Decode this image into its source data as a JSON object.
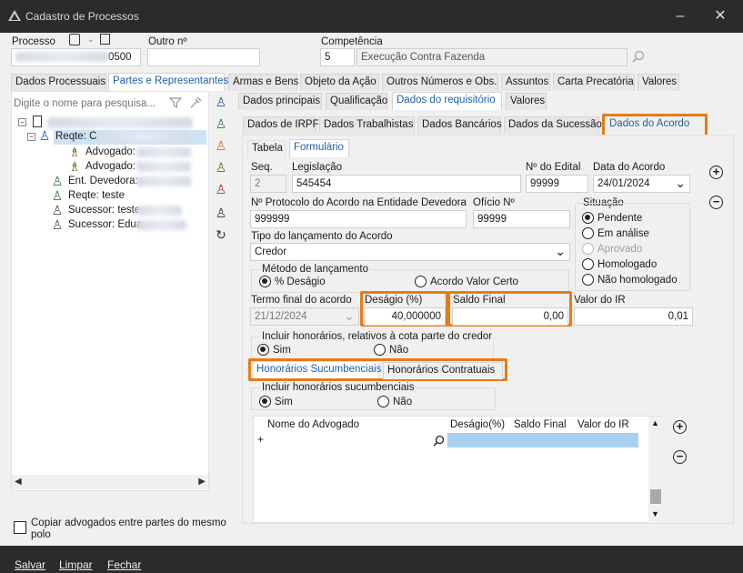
{
  "window": {
    "title": "Cadastro de Processos"
  },
  "header": {
    "processo_label": "Processo",
    "processo_value": "0500",
    "outro_label": "Outro nº",
    "outro_value": "",
    "competencia_label": "Competência",
    "competencia_num": "5",
    "competencia_desc": "Execução Contra Fazenda"
  },
  "main_tabs": [
    "Dados Processuais",
    "Partes e Representantes",
    "Armas e Bens",
    "Objeto da Ação",
    "Outros Números e Obs.",
    "Assuntos",
    "Carta Precatória",
    "Valores"
  ],
  "left": {
    "search_placeholder": "Digite o nome para pesquisa...",
    "tree": [
      {
        "label": "Reqte: C",
        "level": 1
      },
      {
        "label": "Advogado:",
        "level": 2
      },
      {
        "label": "Advogado:",
        "level": 2
      },
      {
        "label": "Ent. Devedora:",
        "level": 1
      },
      {
        "label": "Reqte: teste",
        "level": 1
      },
      {
        "label": "Sucessor: teste",
        "level": 1
      },
      {
        "label": "Sucessor: Edua",
        "level": 1
      }
    ],
    "copy_checkbox_label_1": "Copiar advogados entre partes do mesmo",
    "copy_checkbox_label_2": "polo"
  },
  "sub_tabs": [
    "Dados principais",
    "Qualificação",
    "Dados do requisitório",
    "Valores"
  ],
  "req_tabs": [
    "Dados de IRPF",
    "Dados Trabalhistas",
    "Dados Bancários",
    "Dados da Sucessão",
    "Dados do Acordo"
  ],
  "view_tabs": [
    "Tabela",
    "Formulário"
  ],
  "form": {
    "seq_label": "Seq.",
    "seq_value": "2",
    "legislacao_label": "Legislação",
    "legislacao_value": "545454",
    "edital_label": "Nº do Edital",
    "edital_value": "99999",
    "data_acordo_label": "Data do Acordo",
    "data_acordo_value": "24/01/2024",
    "protocolo_label": "Nº Protocolo do Acordo na Entidade Devedora",
    "protocolo_value": "999999",
    "oficio_label": "Ofício Nº",
    "oficio_value": "99999",
    "situacao_label": "Situação",
    "situacao_options": [
      "Pendente",
      "Em análise",
      "Aprovado",
      "Homologado",
      "Não homologado"
    ],
    "tipo_label": "Tipo do lançamento do Acordo",
    "tipo_value": "Credor",
    "metodo_label": "Método de lançamento",
    "metodo_opt1": "% Deságio",
    "metodo_opt2": "Acordo Valor Certo",
    "termo_label": "Termo final do acordo",
    "termo_value": "21/12/2024",
    "desagio_label": "Deságio (%)",
    "desagio_value": "40,000000",
    "saldo_label": "Saldo Final",
    "saldo_value": "0,00",
    "ir_label": "Valor do IR",
    "ir_value": "0,01",
    "incluir_hon_label": "Incluir honorários, relativos à cota parte do credor",
    "sim": "Sim",
    "nao": "Não",
    "hon_tabs": [
      "Honorários Sucumbenciais",
      "Honorários Contratuais"
    ],
    "incluir_suc_label": "Incluir honorários sucumbenciais",
    "grid_cols": [
      "Nome do Advogado",
      "Deságio(%)",
      "Saldo Final",
      "Valor do IR"
    ]
  },
  "footer": {
    "salvar": "Salvar",
    "limpar": "Limpar",
    "fechar": "Fechar"
  }
}
